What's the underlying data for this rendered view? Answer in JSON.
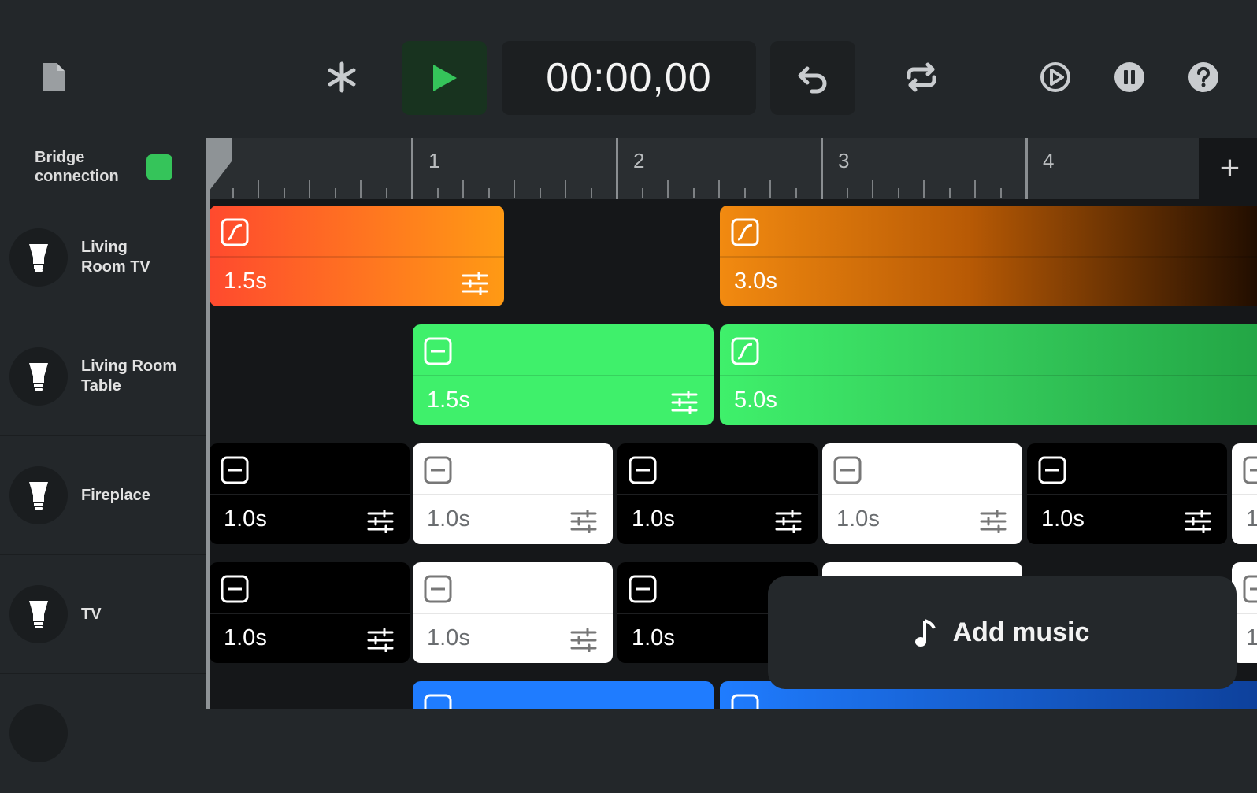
{
  "toolbar": {
    "time": "00:00,00"
  },
  "bridge": {
    "label_line1": "Bridge",
    "label_line2": "connection",
    "status_color": "#35c45a"
  },
  "ruler": {
    "labels": [
      "1",
      "2",
      "3",
      "4"
    ]
  },
  "lights": [
    {
      "line1": "Living",
      "line2": "Room TV"
    },
    {
      "line1": "Living Room",
      "line2": "Table"
    },
    {
      "line1": "Fireplace",
      "line2": ""
    },
    {
      "line1": "TV",
      "line2": ""
    }
  ],
  "clips": {
    "living_room_tv": [
      {
        "duration": "1.5s",
        "icon": "curve-icon"
      },
      {
        "duration": "3.0s",
        "icon": "curve-icon"
      }
    ],
    "living_room_table": [
      {
        "duration": "1.5s",
        "icon": "hold-icon"
      },
      {
        "duration": "5.0s",
        "icon": "curve-icon"
      }
    ],
    "fireplace": [
      {
        "duration": "1.0s"
      },
      {
        "duration": "1.0s"
      },
      {
        "duration": "1.0s"
      },
      {
        "duration": "1.0s"
      },
      {
        "duration": "1.0s"
      },
      {
        "duration": "1"
      }
    ],
    "tv": [
      {
        "duration": "1.0s"
      },
      {
        "duration": "1.0s"
      },
      {
        "duration": "1.0s"
      },
      {
        "duration": "1"
      }
    ]
  },
  "colors": {
    "clip_orange_start": "#ff4a2e",
    "clip_orange_end": "#ff9a14",
    "clip_green": "#3ff06b",
    "clip_blue": "#1f7cff",
    "play_green": "#35c45a"
  },
  "music": {
    "label": "Add music"
  }
}
